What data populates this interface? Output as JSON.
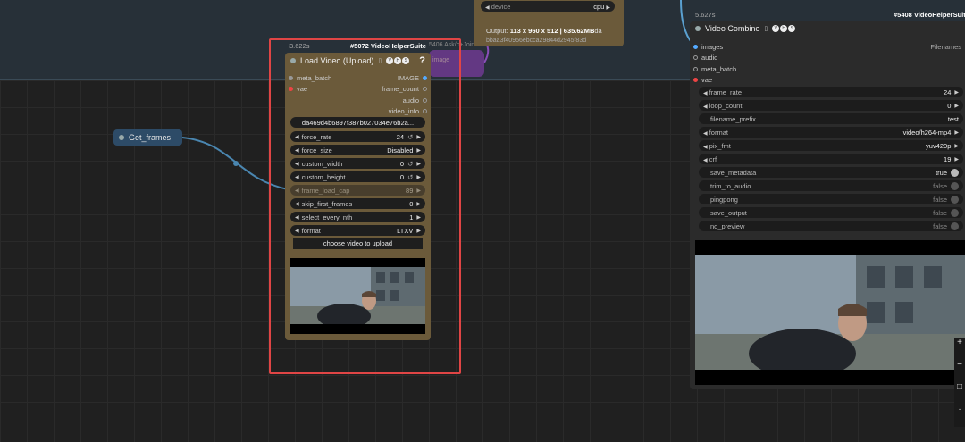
{
  "get_node": {
    "label": "Get_frames"
  },
  "device_node": {
    "device_label": "device",
    "device_value": "cpu",
    "output_prefix": "Output:",
    "output_value": "113 x 960 x 512 | 635.62MB",
    "output_suffix": "da",
    "hash": "bbaa3f40956ebcca29844d2945f83d"
  },
  "ghost": {
    "id": "5406 Ask/c+Join",
    "label": "image"
  },
  "load_video": {
    "time": "3.622s",
    "id": "#5072 VideoHelperSuite",
    "title": "Load Video (Upload)",
    "badges": [
      "V",
      "H",
      "S"
    ],
    "help": "?",
    "inputs": [
      "meta_batch",
      "vae"
    ],
    "outputs": [
      "IMAGE",
      "frame_count",
      "audio",
      "video_info"
    ],
    "filename": "da469d4b6897f387b027034e76b2a...",
    "widgets": [
      {
        "label": "force_rate",
        "value": "24",
        "extra": "↺"
      },
      {
        "label": "force_size",
        "value": "Disabled",
        "extra": ""
      },
      {
        "label": "custom_width",
        "value": "0",
        "extra": "↺"
      },
      {
        "label": "custom_height",
        "value": "0",
        "extra": "↺"
      },
      {
        "label": "frame_load_cap",
        "value": "89",
        "extra": ""
      },
      {
        "label": "skip_first_frames",
        "value": "0",
        "extra": ""
      },
      {
        "label": "select_every_nth",
        "value": "1",
        "extra": ""
      },
      {
        "label": "format",
        "value": "LTXV",
        "extra": ""
      }
    ],
    "upload_button": "choose video to upload"
  },
  "video_combine": {
    "time": "5.627s",
    "id": "#5408 VideoHelperSuit",
    "title": "Video Combine",
    "badges": [
      "V",
      "H",
      "S"
    ],
    "filenames_label": "Filenames",
    "inputs": [
      "images",
      "audio",
      "meta_batch",
      "vae"
    ],
    "widgets": [
      {
        "label": "frame_rate",
        "value": "24"
      },
      {
        "label": "loop_count",
        "value": "0"
      },
      {
        "label": "filename_prefix",
        "value": "test"
      },
      {
        "label": "format",
        "value": "video/h264-mp4"
      },
      {
        "label": "pix_fmt",
        "value": "yuv420p"
      },
      {
        "label": "crf",
        "value": "19"
      }
    ],
    "toggles": [
      {
        "label": "save_metadata",
        "value": "true"
      },
      {
        "label": "trim_to_audio",
        "value": "false"
      },
      {
        "label": "pingpong",
        "value": "false"
      },
      {
        "label": "save_output",
        "value": "false"
      },
      {
        "label": "no_preview",
        "value": "false"
      }
    ]
  },
  "colors": {
    "node_brown": "#6b5a3a",
    "highlight": "#e04545",
    "link_blue": "#5aa0d0",
    "link_purple": "#8a4fb8"
  }
}
